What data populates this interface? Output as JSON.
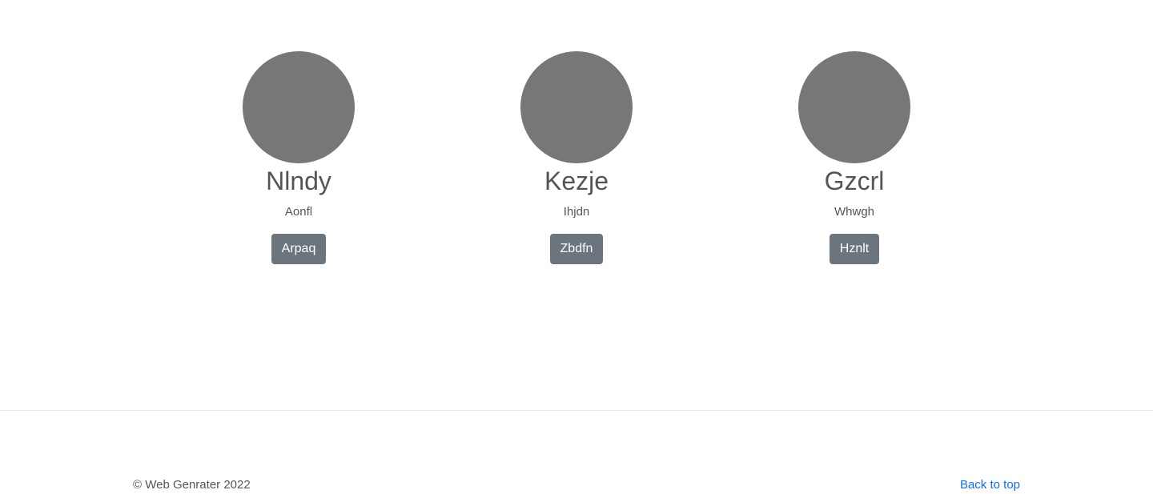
{
  "profiles": [
    {
      "name": "Nlndy",
      "subtitle": "Aonfl",
      "button_label": "Arpaq"
    },
    {
      "name": "Kezje",
      "subtitle": "Ihjdn",
      "button_label": "Zbdfn"
    },
    {
      "name": "Gzcrl",
      "subtitle": "Whwgh",
      "button_label": "Hznlt"
    }
  ],
  "footer": {
    "copyright": "© Web Genrater 2022",
    "back_to_top": "Back to top"
  },
  "colors": {
    "avatar": "#777777",
    "button": "#6c757d",
    "link": "#0d6efd"
  }
}
